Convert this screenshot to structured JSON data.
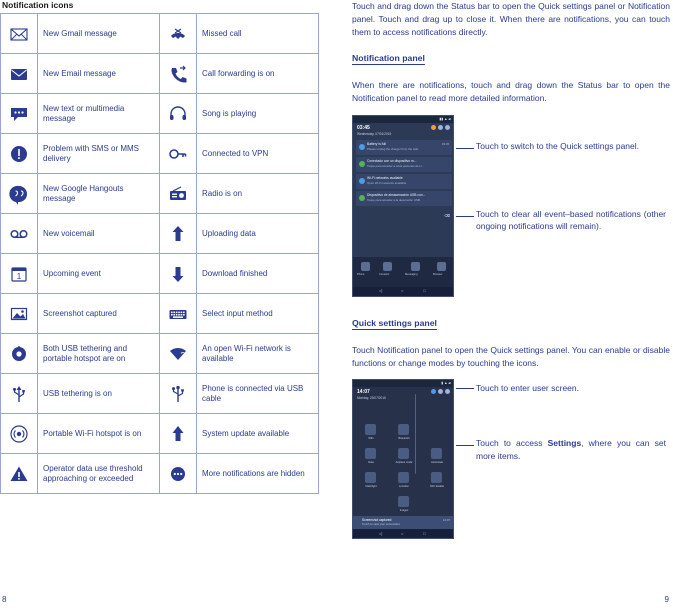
{
  "page": {
    "left_number": "8",
    "right_number": "9"
  },
  "left": {
    "title": "Notification icons",
    "rows": [
      {
        "icon_left": "envelope-gmail-icon",
        "label_left": "New Gmail message",
        "icon_right": "missed-call-icon",
        "label_right": "Missed call"
      },
      {
        "icon_left": "envelope-icon",
        "label_left": "New Email message",
        "icon_right": "call-forwarding-icon",
        "label_right": "Call forwarding is on"
      },
      {
        "icon_left": "message-bubble-icon",
        "label_left": "New text or multimedia message",
        "icon_right": "headphones-icon",
        "label_right": "Song is playing"
      },
      {
        "icon_left": "warning-circle-icon",
        "label_left": "Problem with SMS or MMS delivery",
        "icon_right": "key-vpn-icon",
        "label_right": "Connected to VPN"
      },
      {
        "icon_left": "hangouts-icon",
        "label_left": "New Google Hangouts message",
        "icon_right": "radio-icon",
        "label_right": "Radio is on"
      },
      {
        "icon_left": "voicemail-icon",
        "label_left": "New voicemail",
        "icon_right": "upload-arrow-icon",
        "label_right": "Uploading data"
      },
      {
        "icon_left": "calendar-event-icon",
        "label_left": "Upcoming event",
        "icon_right": "download-arrow-icon",
        "label_right": "Download finished"
      },
      {
        "icon_left": "screenshot-icon",
        "label_left": "Screenshot captured",
        "icon_right": "keyboard-icon",
        "label_right": "Select input method"
      },
      {
        "icon_left": "usb-tethering-hotspot-icon",
        "label_left": "Both USB tethering and portable hotspot are on",
        "icon_right": "wifi-question-icon",
        "label_right": "An open Wi-Fi network is available"
      },
      {
        "icon_left": "usb-icon",
        "label_left": "USB tethering is on",
        "icon_right": "usb-cable-icon",
        "label_right": "Phone is connected via USB cable"
      },
      {
        "icon_left": "hotspot-icon",
        "label_left": "Portable Wi-Fi hotspot is on",
        "icon_right": "update-arrow-icon",
        "label_right": "System update available"
      },
      {
        "icon_left": "alert-triangle-icon",
        "label_left": "Operator data use threshold approaching or exceeded",
        "icon_right": "more-dots-icon",
        "label_right": "More notifications are hidden"
      }
    ]
  },
  "right": {
    "intro": "Touch and drag down the Status bar to open the Quick settings panel or Notification panel. Touch and drag up to close it. When there are notifications, you can touch them to access notifications directly.",
    "notification_panel": {
      "heading": "Notification panel",
      "body": "When there are notifications, touch and drag down the Status bar to open the Notification panel to read more detailed information.",
      "callout_1": "Touch to switch to the Quick settings panel.",
      "callout_2": "Touch to clear all event–based notifications (other ongoing notifications will remain)."
    },
    "quick_settings": {
      "heading": "Quick settings panel",
      "body": "Touch Notification panel to open the Quick settings panel. You can enable or disable functions or change modes by touching the icons.",
      "callout_1": "Touch to enter user screen.",
      "callout_2_pre": "Touch to access ",
      "callout_2_bold": "Settings",
      "callout_2_post": ", where you can set more items."
    },
    "phone_notification": {
      "status_time": "03:45",
      "status_date": "Wednesday, 07/01/2015",
      "notifications": [
        {
          "title": "Battery is full",
          "sub": "Please unplug the charger from the wall.",
          "time": "03:45"
        },
        {
          "title": "Conectado con un dispositivo m...",
          "sub": "Toque para acceder a otras opciones de U..."
        },
        {
          "title": "Wi-Fi networks available",
          "sub": "Open Wi-Fi networks available"
        },
        {
          "title": "Dispositivo de almacenación USB con...",
          "sub": "Toque para acceder a la depuración USB."
        }
      ],
      "dock_labels": [
        "Phone",
        "Contacts",
        "Messaging",
        "Browser"
      ]
    },
    "phone_quick_settings": {
      "status_time": "14:07",
      "status_date": "Monday, 23/07/2015",
      "tiles": [
        [
          "WiFi",
          "Bluetooth",
          ""
        ],
        [
          "Data",
          "Airplane mode",
          "Autorotate"
        ],
        [
          "Flashlight",
          "Location",
          "NFC Enable"
        ],
        [
          "",
          "Images",
          ""
        ]
      ],
      "snapshot_title": "Screenshot captured",
      "snapshot_sub": "Touch to view your screenshot.",
      "snapshot_time": "14:07"
    }
  }
}
